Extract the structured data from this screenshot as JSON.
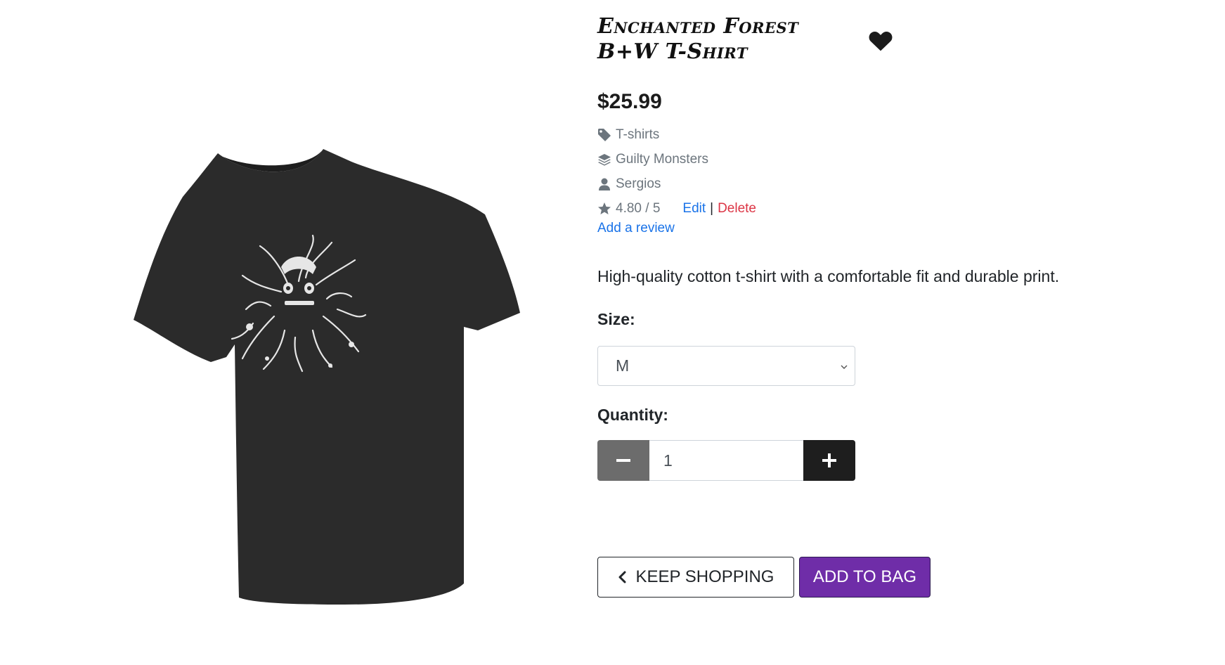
{
  "product": {
    "title": "Enchanted Forest B+W T-Shirt",
    "price": "$25.99",
    "category": "T-shirts",
    "collection": "Guilty Monsters",
    "author": "Sergios",
    "rating": "4.80 / 5",
    "edit_label": "Edit",
    "separator": "|",
    "delete_label": "Delete",
    "add_review_label": "Add a review",
    "description": "High-quality cotton t-shirt with a comfortable fit and durable print.",
    "image_alt": "Enchanted Forest B+W T-Shirt"
  },
  "size": {
    "label": "Size:",
    "selected": "M"
  },
  "quantity": {
    "label": "Quantity:",
    "value": "1"
  },
  "actions": {
    "keep_shopping_label": "KEEP SHOPPING",
    "add_to_bag_label": "ADD TO BAG"
  },
  "colors": {
    "primary_button": "#6f2da8",
    "link": "#1a73e8",
    "delete": "#dc3545",
    "muted": "#6c757d",
    "shirt": "#2b2b2b"
  },
  "icons": {
    "wishlist": "heart-icon",
    "category": "tag-icon",
    "collection": "layers-icon",
    "author": "user-icon",
    "rating": "star-icon",
    "minus": "minus-icon",
    "plus": "plus-icon",
    "back": "chevron-left-icon"
  }
}
